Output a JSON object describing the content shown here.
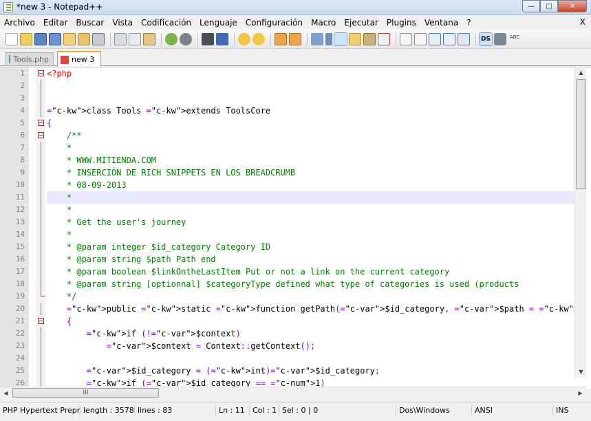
{
  "window": {
    "title": "*new  3 - Notepad++"
  },
  "menu": [
    "Archivo",
    "Editar",
    "Buscar",
    "Vista",
    "Codificación",
    "Lenguaje",
    "Configuración",
    "Macro",
    "Ejecutar",
    "Plugins",
    "Ventana",
    "?"
  ],
  "menu_close": "X",
  "toolbar_icons": [
    "new-file-icon",
    "open-file-icon",
    "save-icon",
    "save-all-icon",
    "close-icon",
    "close-all-icon",
    "print-icon",
    "cut-icon",
    "copy-icon",
    "paste-icon",
    "undo-icon",
    "redo-icon",
    "find-icon",
    "replace-icon",
    "zoom-in-icon",
    "zoom-out-icon",
    "sync-v-icon",
    "sync-h-icon",
    "wrap-icon",
    "all-chars-icon",
    "indent-guide-icon",
    "user-lang-icon",
    "doc-map-icon",
    "function-list-icon",
    "record-macro-icon",
    "stop-macro-icon",
    "play-macro-icon",
    "run-macro-icon",
    "save-macro-icon",
    "ds-icon",
    "plugin-icon",
    "spellcheck-icon"
  ],
  "tabs": [
    {
      "label": "Tools.php",
      "active": false
    },
    {
      "label": "new  3",
      "active": true
    }
  ],
  "editor": {
    "highlighted_line": 11,
    "lines": [
      {
        "n": "1",
        "text": "<?php"
      },
      {
        "n": "2",
        "text": ""
      },
      {
        "n": "3",
        "text": ""
      },
      {
        "n": "4",
        "text": "class Tools extends ToolsCore"
      },
      {
        "n": "5",
        "text": "{"
      },
      {
        "n": "6",
        "text": "    /**"
      },
      {
        "n": "7",
        "text": "    *"
      },
      {
        "n": "8",
        "text": "    * WWW.MITIENDA.COM"
      },
      {
        "n": "9",
        "text": "    * INSERCIÓN DE RICH SNIPPETS EN LOS BREADCRUMB"
      },
      {
        "n": "10",
        "text": "    * 08-09-2013"
      },
      {
        "n": "11",
        "text": "    *"
      },
      {
        "n": "12",
        "text": "    *"
      },
      {
        "n": "13",
        "text": "    * Get the user's journey"
      },
      {
        "n": "14",
        "text": "    *"
      },
      {
        "n": "15",
        "text": "    * @param integer $id_category Category ID"
      },
      {
        "n": "16",
        "text": "    * @param string $path Path end"
      },
      {
        "n": "17",
        "text": "    * @param boolean $linkOntheLastItem Put or not a link on the current category"
      },
      {
        "n": "18",
        "text": "    * @param string [optionnal] $categoryType defined what type of categories is used (products"
      },
      {
        "n": "19",
        "text": "    */"
      },
      {
        "n": "20",
        "text": "    public static function getPath($id_category, $path = '', $link_on_the_item = false, $categor"
      },
      {
        "n": "21",
        "text": "    {"
      },
      {
        "n": "22",
        "text": "        if (!$context)"
      },
      {
        "n": "23",
        "text": "            $context = Context::getContext();"
      },
      {
        "n": "24",
        "text": ""
      },
      {
        "n": "25",
        "text": "        $id_category = (int)$id_category;"
      },
      {
        "n": "26",
        "text": "        if ($id_category == 1)"
      }
    ]
  },
  "hscroll_grip": "III",
  "status": {
    "lang": "PHP Hypertext Prepr",
    "length": "length : 3578",
    "lines": "lines : 83",
    "ln": "Ln : 11",
    "col": "Col : 1",
    "sel": "Sel : 0 | 0",
    "eol": "Dos\\Windows",
    "encoding": "ANSI",
    "mode": "INS"
  },
  "colors": {
    "keyword": "#0000ff",
    "comment": "#008000",
    "php_tag": "#ff0000",
    "highlight_line": "#e8e8ff",
    "tab_accent": "#f7a832"
  }
}
